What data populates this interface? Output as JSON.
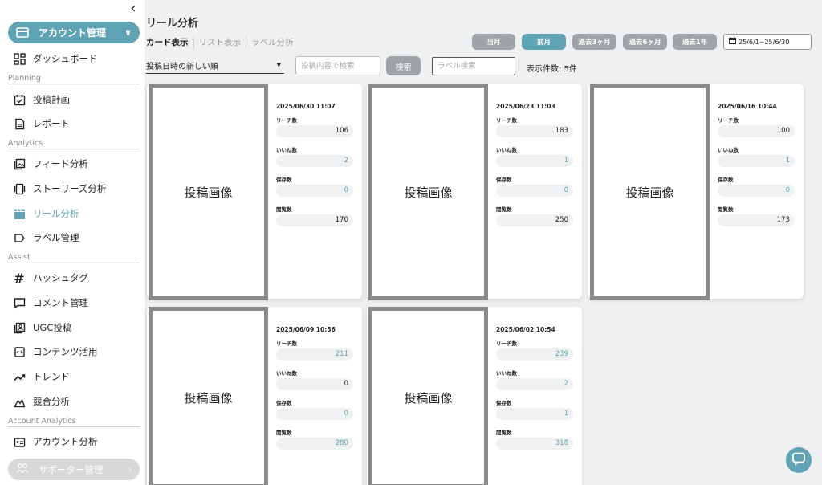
{
  "sidebar": {
    "account_label": "アカウント管理",
    "items": {
      "dashboard": "ダッシュボード",
      "plan": "投稿計画",
      "report": "レポート",
      "feed": "フィード分析",
      "stories": "ストーリーズ分析",
      "reel": "リール分析",
      "label": "ラベル管理",
      "hashtag": "ハッシュタグ",
      "comment": "コメント管理",
      "ugc": "UGC投稿",
      "content": "コンテンツ活用",
      "trend": "トレンド",
      "competitor": "競合分析",
      "account_analysis": "アカウント分析"
    },
    "sections": {
      "planning": "Planning",
      "analytics": "Analytics",
      "assist": "Assist",
      "account_analytics": "Account Analytics"
    },
    "supporter_label": "サポーター管理",
    "active_item": "reel"
  },
  "header": {
    "title": "リール分析",
    "view_tabs": [
      "カード表示",
      "リスト表示",
      "ラベル分析"
    ]
  },
  "periods": [
    "当月",
    "前月",
    "過去3ヶ月",
    "過去6ヶ月",
    "過去1年"
  ],
  "active_period": "前月",
  "date_range": "25/6/1~25/6/30",
  "filters": {
    "sort_value": "投稿日時の新しい順",
    "search_placeholder": "投稿内容で検索",
    "search_button": "検索",
    "label_placeholder": "ラベル検索",
    "count_text": "表示件数: 5件"
  },
  "stat_labels": {
    "reach": "リーチ数",
    "likes": "いいね数",
    "saves": "保存数",
    "views": "閲覧数"
  },
  "image_placeholder": "投稿画像",
  "posts": [
    {
      "date": "2025/06/30 11:07",
      "reach": "106",
      "likes": "2",
      "saves": "0",
      "views": "170"
    },
    {
      "date": "2025/06/23 11:03",
      "reach": "183",
      "likes": "1",
      "saves": "0",
      "views": "250"
    },
    {
      "date": "2025/06/16 10:44",
      "reach": "100",
      "likes": "1",
      "saves": "0",
      "views": "173"
    },
    {
      "date": "2025/06/09 10:56",
      "reach": "211",
      "likes": "0",
      "saves": "0",
      "views": "280"
    },
    {
      "date": "2025/06/02 10:54",
      "reach": "239",
      "likes": "2",
      "saves": "1",
      "views": "318"
    }
  ],
  "colors": {
    "accent": "#5fa3b5",
    "inactive": "#9ea3a6"
  }
}
